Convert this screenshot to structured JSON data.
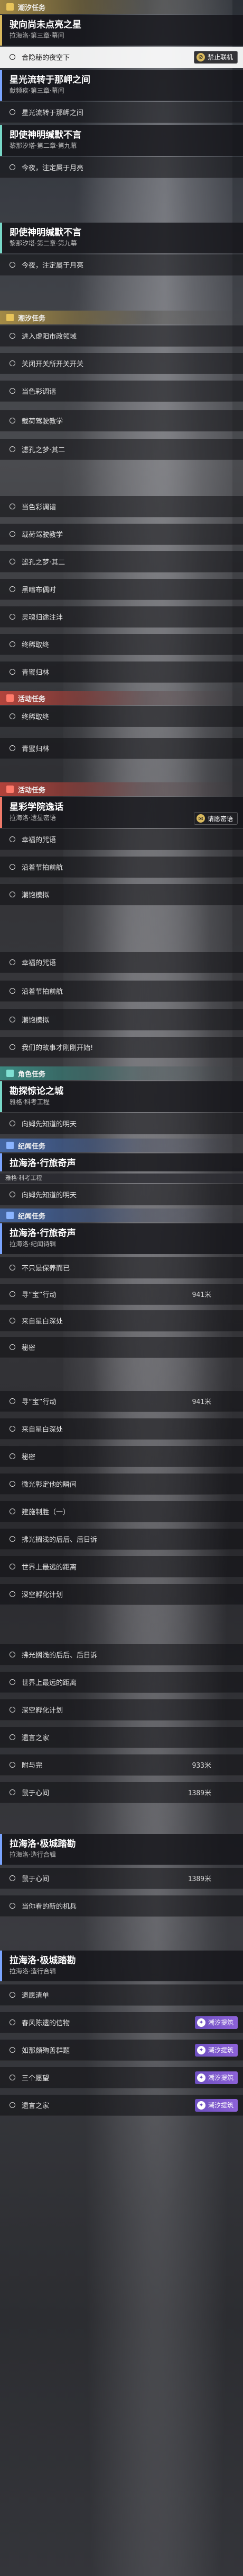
{
  "sections": [
    {
      "label": "潮汐任务"
    },
    {
      "label": "潮汐任务"
    },
    {
      "label": "活动任务"
    },
    {
      "label": "活动任务"
    },
    {
      "label": "角色任务"
    },
    {
      "label": "纪闻任务"
    },
    {
      "label": "纪闻任务"
    }
  ],
  "quests": [
    {
      "title": "驶向尚未点亮之星",
      "sub": "拉海洛·第三章·幕间"
    },
    {
      "title": "星光流转于那岬之间",
      "sub": "献频疾·第三章·幕间"
    },
    {
      "title": "即使神明缄默不言",
      "sub": "黎那汐塔·第二章·第九幕"
    },
    {
      "title": "即使神明缄默不言",
      "sub": "黎那汐塔·第二章·第九幕"
    },
    {
      "title": "星彩学院逸话",
      "sub": "拉海洛·遗星密语"
    },
    {
      "title": "勘探惊论之城",
      "sub": "雅格·科考工程"
    },
    {
      "title": "拉海洛·行旅奇声",
      "sub": ""
    },
    {
      "title": "拉海洛·行旅奇声",
      "sub": "拉海洛·纪闻诗辑"
    },
    {
      "title": "拉海洛·极城踏勘",
      "sub": "拉海洛·造行合辑"
    },
    {
      "title": "拉海洛·极城踏勘",
      "sub": "拉海洛·造行合辑"
    }
  ],
  "objectives": [
    {
      "text": "合隐秘的夜空下"
    },
    {
      "text": "星光流转于那岬之间"
    },
    {
      "text": "今夜，注定属于月亮"
    },
    {
      "text": "今夜，注定属于月亮"
    },
    {
      "text": "进入虚阳市政领域"
    },
    {
      "text": "关闭开关所开关开关"
    },
    {
      "text": "当色彩调谐"
    },
    {
      "text": "载荷驾驶教学"
    },
    {
      "text": "滤孔之梦·其二"
    },
    {
      "text": "当色彩调谐"
    },
    {
      "text": "载荷驾驶教学"
    },
    {
      "text": "滤孔之梦·其二"
    },
    {
      "text": "黑暗布偶时"
    },
    {
      "text": "灵魂归途注沣"
    },
    {
      "text": "终稀取终"
    },
    {
      "text": "青蜜归林"
    },
    {
      "text": "终稀取终"
    },
    {
      "text": "青蜜归林"
    },
    {
      "text": "幸福的咒语"
    },
    {
      "text": "沿着节拍前航"
    },
    {
      "text": "潮饱模拟"
    },
    {
      "text": "幸福的咒语"
    },
    {
      "text": "沿着节拍前航"
    },
    {
      "text": "潮饱模拟"
    },
    {
      "text": "我们的故事才刚刚开始!"
    },
    {
      "text": "向姆先知道的明天"
    },
    {
      "text": "向姆先知道的明天"
    },
    {
      "text": "不只是保养而已"
    },
    {
      "text": "寻“宝”行动",
      "dist": "941米"
    },
    {
      "text": "来自星白深处"
    },
    {
      "text": "秘密"
    },
    {
      "text": "寻“宝”行动",
      "dist": "941米"
    },
    {
      "text": "来自星白深处"
    },
    {
      "text": "秘密"
    },
    {
      "text": "微光彰定他的瞬间"
    },
    {
      "text": "建施制胜（一）"
    },
    {
      "text": "拂光搁浅的后后、后日诉"
    },
    {
      "text": "世界上最远的距离"
    },
    {
      "text": "深空孵化计划"
    },
    {
      "text": "拂光搁浅的后后、后日诉"
    },
    {
      "text": "世界上最远的距离"
    },
    {
      "text": "深空孵化计划"
    },
    {
      "text": "遗言之家"
    },
    {
      "text": "附与完",
      "dist": "933米"
    },
    {
      "text": "鼠于心间",
      "dist": "1389米"
    },
    {
      "text": "鼠于心间",
      "dist": "1389米"
    },
    {
      "text": "当你看的新的机兵"
    },
    {
      "text": "遗愿清单"
    },
    {
      "text": "春风陈遗的信物"
    },
    {
      "text": "如那颇殉善群题"
    },
    {
      "text": "三个愿望"
    },
    {
      "text": "遗言之家"
    }
  ],
  "badges": {
    "lock_label": "禁止联机",
    "dream_label": "请愿密语",
    "tide_label": "潮汐提筑"
  },
  "small_tags": [
    {
      "text": "雅格·科考工程"
    }
  ]
}
